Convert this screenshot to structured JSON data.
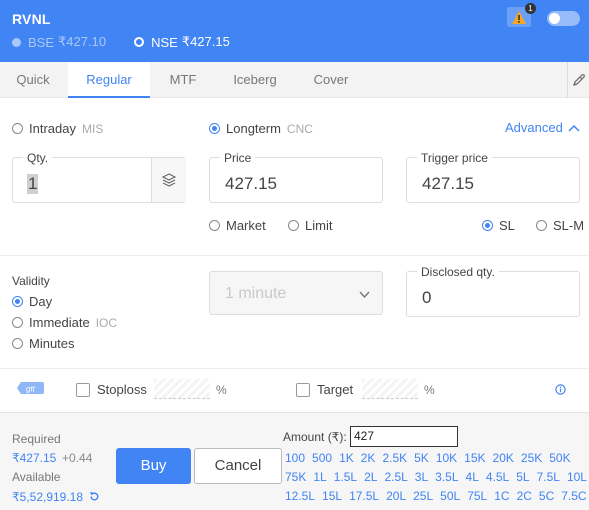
{
  "header": {
    "symbol": "RVNL",
    "bse": {
      "label": "BSE",
      "price": "₹427.10"
    },
    "nse": {
      "label": "NSE",
      "price": "₹427.15"
    },
    "alert_count": "1"
  },
  "tabs": [
    "Quick",
    "Regular",
    "MTF",
    "Iceberg",
    "Cover"
  ],
  "active_tab": "Regular",
  "product": {
    "intraday": {
      "label": "Intraday",
      "code": "MIS"
    },
    "longterm": {
      "label": "Longterm",
      "code": "CNC"
    },
    "advanced": "Advanced"
  },
  "qty": {
    "label": "Qty.",
    "value": "1"
  },
  "price": {
    "label": "Price",
    "value": "427.15"
  },
  "trigger": {
    "label": "Trigger price",
    "value": "427.15"
  },
  "order_types": {
    "market": "Market",
    "limit": "Limit",
    "sl": "SL",
    "slm": "SL-M"
  },
  "validity": {
    "title": "Validity",
    "day": "Day",
    "immediate": "Immediate",
    "ioc": "IOC",
    "minutes": "Minutes",
    "minutes_select": "1 minute"
  },
  "disclosed": {
    "label": "Disclosed qty.",
    "value": "0"
  },
  "gtt": {
    "icon": "gtt",
    "stoploss": "Stoploss",
    "target": "Target",
    "pct": "%"
  },
  "footer": {
    "required_label": "Required",
    "required_value": "₹427.15",
    "required_delta": "+0.44",
    "available_label": "Available",
    "available_value": "₹5,52,919.18",
    "buy": "Buy",
    "cancel": "Cancel",
    "amount_label": "Amount (₹):",
    "amount_value": "427"
  },
  "amount_chips": [
    [
      "100",
      "500",
      "1K",
      "2K",
      "2.5K",
      "5K",
      "10K",
      "15K",
      "20K",
      "25K",
      "50K"
    ],
    [
      "75K",
      "1L",
      "1.5L",
      "2L",
      "2.5L",
      "3L",
      "3.5L",
      "4L",
      "4.5L",
      "5L",
      "7.5L",
      "10L"
    ],
    [
      "12.5L",
      "15L",
      "17.5L",
      "20L",
      "25L",
      "50L",
      "75L",
      "1C",
      "2C",
      "5C",
      "7.5C"
    ]
  ],
  "colors": {
    "accent": "#4184f3",
    "header_bg": "#4184f3",
    "warning": "#f5a623"
  }
}
